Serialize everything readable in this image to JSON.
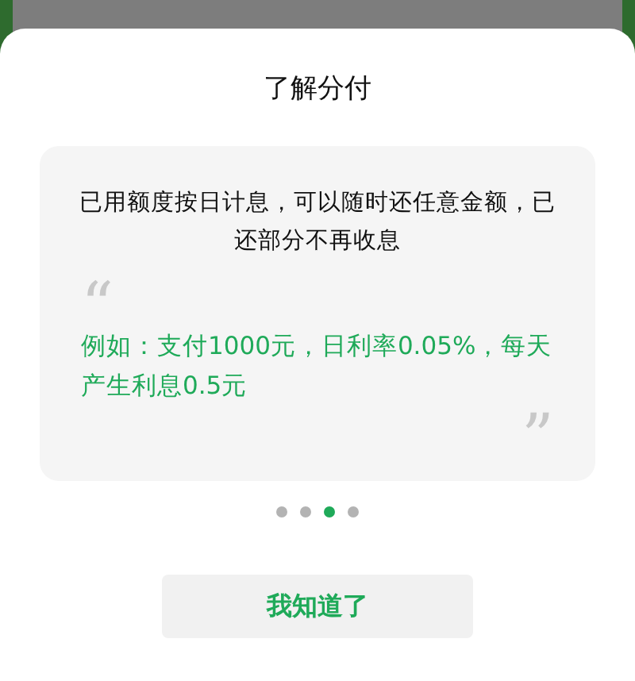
{
  "dialog": {
    "title": "了解分付",
    "description": "已用额度按日计息，可以随时还任意金额，已还部分不再收息",
    "quote": {
      "open_mark": "“",
      "example": "例如：支付1000元，日利率0.05%，每天产生利息0.5元",
      "close_mark": "”"
    },
    "pages": [
      {
        "selected": false
      },
      {
        "selected": false
      },
      {
        "selected": true
      },
      {
        "selected": false
      }
    ],
    "button": "我知道了"
  }
}
